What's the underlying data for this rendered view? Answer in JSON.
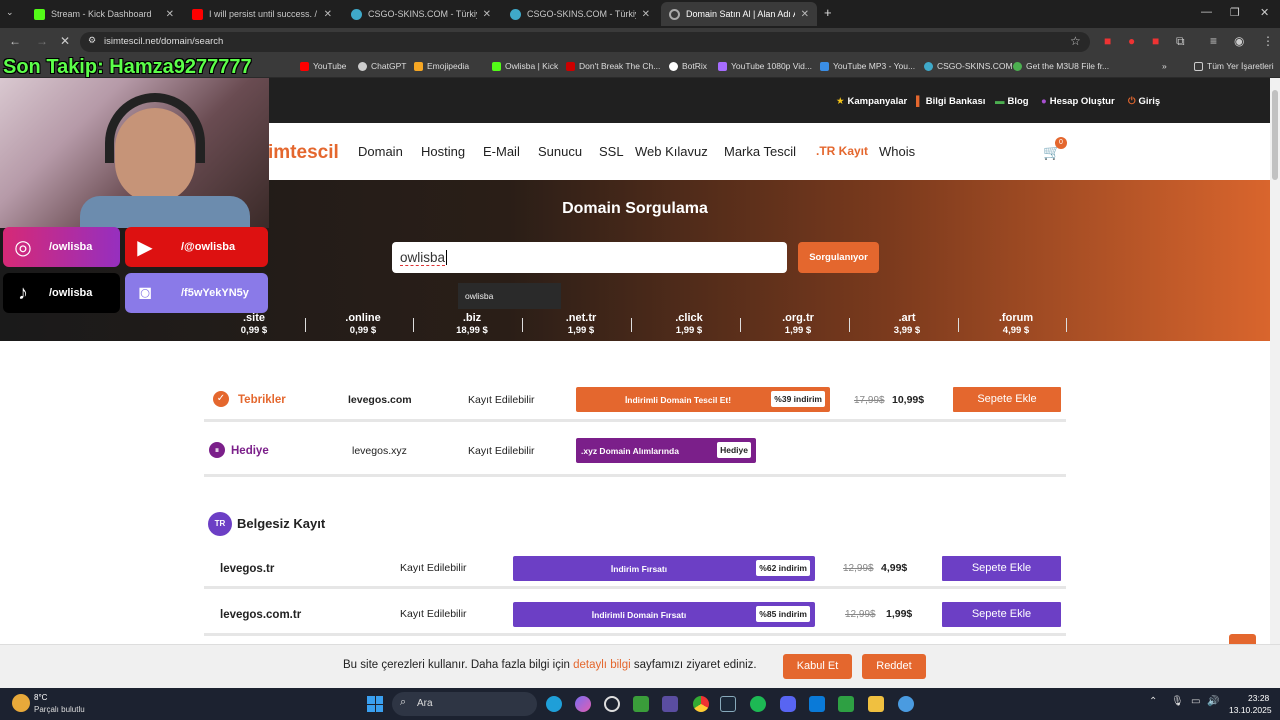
{
  "tabs": [
    {
      "title": "Stream - Kick Dashboard",
      "color": "#53fc18"
    },
    {
      "title": "I will persist until success. / Jazz",
      "color": "#ff0000"
    },
    {
      "title": "CSGO-SKINS.COM - Türkiye'nin",
      "color": "#3fa9c9"
    },
    {
      "title": "CSGO-SKINS.COM - Türkiye'nin",
      "color": "#3fa9c9"
    },
    {
      "title": "Domain Satın Al | Alan Adı Aran",
      "color": "#888888"
    }
  ],
  "url": "isimtescil.net/domain/search",
  "bookmarks": [
    "YouTube",
    "ChatGPT",
    "Emojipedia",
    "Owlisba | Kick",
    "Don't Break The Ch...",
    "BotRix",
    "YouTube 1080p Vid...",
    "YouTube MP3 - You...",
    "CSGO-SKINS.COM",
    "Get the M3U8 File fr...",
    "Tüm Yer İşaretleri"
  ],
  "top_links": [
    "Kampanyalar",
    "Bilgi Bankası",
    "Blog",
    "Hesap Oluştur",
    "Giriş"
  ],
  "logo": "imtescil",
  "nav": [
    "Domain",
    "Hosting",
    "E-Mail",
    "Sunucu",
    "SSL",
    "Web Kılavuz",
    "Marka Tescil",
    ".TR Kayıt",
    "Whois"
  ],
  "cart_count": "0",
  "hero": {
    "title": "Domain Sorgulama",
    "query": "owlisba",
    "button": "Sorgulanıyor",
    "suggestion": "owlisba"
  },
  "tlds": [
    {
      "ext": ".site",
      "price": "0,99 $"
    },
    {
      "ext": ".online",
      "price": "0,99 $"
    },
    {
      "ext": ".biz",
      "price": "18,99 $"
    },
    {
      "ext": ".net.tr",
      "price": "1,99 $"
    },
    {
      "ext": ".click",
      "price": "1,99 $"
    },
    {
      "ext": ".org.tr",
      "price": "1,99 $"
    },
    {
      "ext": ".art",
      "price": "3,99 $"
    },
    {
      "ext": ".forum",
      "price": "4,99 $"
    }
  ],
  "results": [
    {
      "label": "Tebrikler",
      "domain": "levegos.com",
      "status": "Kayıt Edilebilir",
      "promo": "İndirimli Domain Tescil Et!",
      "badge": "%39 indirim",
      "old": "17,99$",
      "new": "10,99$",
      "action": "Sepete Ekle"
    },
    {
      "label": "Hediye",
      "domain": "levegos.xyz",
      "status": "Kayıt Edilebilir",
      "promo": ".xyz Domain Alımlarında",
      "badge": "Hediye"
    }
  ],
  "section": {
    "badge": "TR",
    "title": "Belgesiz Kayıt"
  },
  "tr_results": [
    {
      "domain": "levegos.tr",
      "status": "Kayıt Edilebilir",
      "promo": "İndirim Fırsatı",
      "badge": "%62 indirim",
      "old": "12,99$",
      "new": "4,99$",
      "action": "Sepete Ekle"
    },
    {
      "domain": "levegos.com.tr",
      "status": "Kayıt Edilebilir",
      "promo": "İndirimli Domain Fırsatı",
      "badge": "%85 indirim",
      "old": "12,99$",
      "new": "1,99$",
      "action": "Sepete Ekle"
    }
  ],
  "cookie": {
    "text_before": "Bu site çerezleri kullanır. Daha fazla bilgi için",
    "link": "detaylı bilgi",
    "text_after": "sayfamızı ziyaret ediniz.",
    "accept": "Kabul Et",
    "reject": "Reddet"
  },
  "taskbar": {
    "temp": "8°C",
    "weather": "Parçalı bulutlu",
    "search": "Ara",
    "time": "23:28",
    "date": "13.10.2025"
  },
  "stream_overlay": {
    "follower": "Son Takip: Hamza9277777",
    "instagram": "/owlisba",
    "youtube": "/@owlisba",
    "tiktok": "/owlisba",
    "discord": "/f5wYekYN5y"
  },
  "colors": {
    "accent": "#e4672e",
    "purple": "#6c3fc5",
    "dark_purple": "#7b1f8a"
  }
}
